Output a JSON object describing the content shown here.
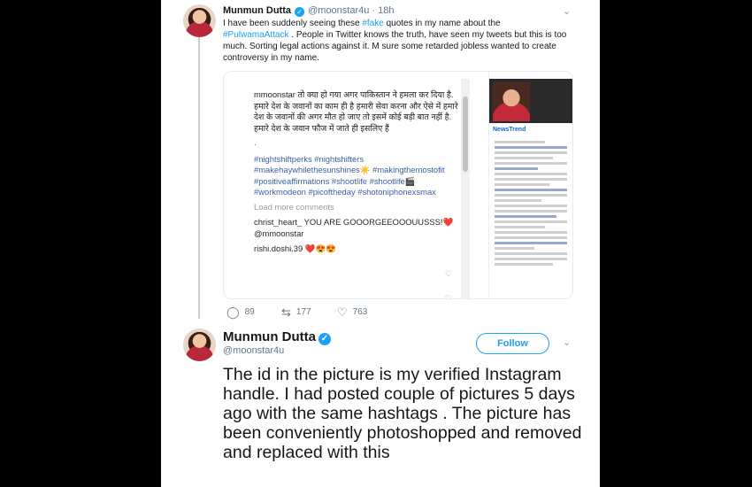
{
  "tweet1": {
    "name": "Munmun Dutta",
    "handle": "@moonstar4u",
    "separator": "·",
    "time": "18h",
    "text_before": "I have been suddenly seeing these ",
    "hashtag1": "#fake",
    "text_mid": " quotes in my name about the ",
    "hashtag2": "#PulwamaAttack",
    "text_after": " . People in Twitter knows the truth, have seen my tweets but this is too much. Sorting legal actions against it. M sure some retarded jobless wanted to create controversy in my name.",
    "replies": "89",
    "retweets": "177",
    "likes": "763"
  },
  "screenshot": {
    "post_user": "mmoonstar",
    "post_text": "तो क्या हो गया अगर पाकिस्तान ने हमला कर दिया है. हमारे देश के जवानों का काम ही है हमारी सेवा करना और ऐसे में हमारे देश के जवानों की अगर मौत हो जाए तो इसमें कोई बड़ी बात नहीं है. हमारे देश के जवान फौज में जाते ही इसलिए हैं",
    "dot": ".",
    "tags": "#nightshiftperks #nightshifters #makehaywhilethesunshines☀️ #makingthemostofit #positiveaffirmations #shootlife #shootlife🎬 #workmodeon #picoftheday #shotoniphonexsmax",
    "load_more": "Load more comments",
    "comment1_user": "christ_heart_",
    "comment1_text": " YOU ARE GOOORGEEOOOUUSSS!❤️ @mmoonstar",
    "comment2_user": "rishi.doshi.39",
    "comment2_text": " ❤️😍😍",
    "right_brand": "NewsTrend"
  },
  "tweet2": {
    "name": "Munmun Dutta",
    "handle": "@moonstar4u",
    "follow_label": "Follow",
    "text": "The id in the picture is my verified Instagram handle. I had posted couple of pictures 5 days ago with the same hashtags . The picture has been conveniently photoshopped and removed and replaced with this"
  },
  "icons": {
    "verified": "verified-badge-icon",
    "caret": "chevron-down-icon",
    "reply": "reply-icon",
    "retweet": "retweet-icon",
    "like": "heart-icon"
  },
  "colors": {
    "accent": "#1da1f2",
    "text": "#14171a",
    "muted": "#657786"
  }
}
